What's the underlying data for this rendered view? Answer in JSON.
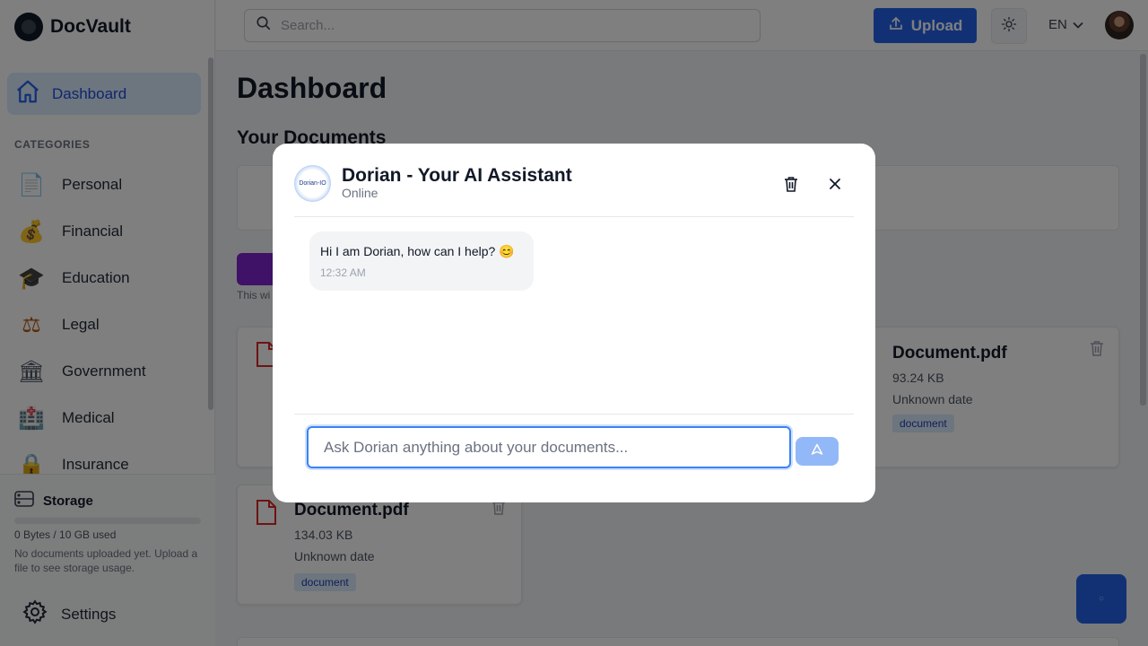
{
  "app": {
    "name": "DocVault"
  },
  "sidebar": {
    "dashboard_label": "Dashboard",
    "categories_title": "CATEGORIES",
    "categories": [
      {
        "label": "Personal",
        "icon": "document-icon",
        "glyph": "📄"
      },
      {
        "label": "Financial",
        "icon": "money-bag-icon",
        "glyph": "💰"
      },
      {
        "label": "Education",
        "icon": "graduation-cap-icon",
        "glyph": "🎓"
      },
      {
        "label": "Legal",
        "icon": "scales-icon",
        "glyph": "⚖"
      },
      {
        "label": "Government",
        "icon": "government-building-icon",
        "glyph": "🏛"
      },
      {
        "label": "Medical",
        "icon": "medical-icon",
        "glyph": "🏥"
      },
      {
        "label": "Insurance",
        "icon": "lock-icon",
        "glyph": "🔒"
      }
    ],
    "storage_title": "Storage",
    "storage_used": "0 Bytes / 10 GB used",
    "storage_fraction": 0,
    "storage_note": "No documents uploaded yet. Upload a file to see storage usage.",
    "settings_label": "Settings"
  },
  "header": {
    "search_placeholder": "Search...",
    "upload_label": "Upload",
    "language": "EN"
  },
  "main": {
    "title": "Dashboard",
    "section_title": "Your Documents",
    "hint": "This wi",
    "documents": [
      {
        "name": "Document.pdf",
        "size": "93.24 KB",
        "date": "Unknown date",
        "tag": "document"
      },
      {
        "name": "Document.pdf",
        "size": "134.03 KB",
        "date": "Unknown date",
        "tag": "document"
      }
    ],
    "fab_glyph": "○"
  },
  "chat": {
    "avatar_text": "Dorian-IO",
    "title": "Dorian - Your AI Assistant",
    "status": "Online",
    "messages": [
      {
        "text": "Hi I am Dorian, how can I help? 😊",
        "time": "12:32 AM"
      }
    ],
    "input_placeholder": "Ask Dorian anything about your documents..."
  },
  "colors": {
    "accent": "#2563eb",
    "active_nav_bg": "#dbeafe",
    "pdf_red": "#dc2626",
    "purple": "#7e22ce"
  }
}
